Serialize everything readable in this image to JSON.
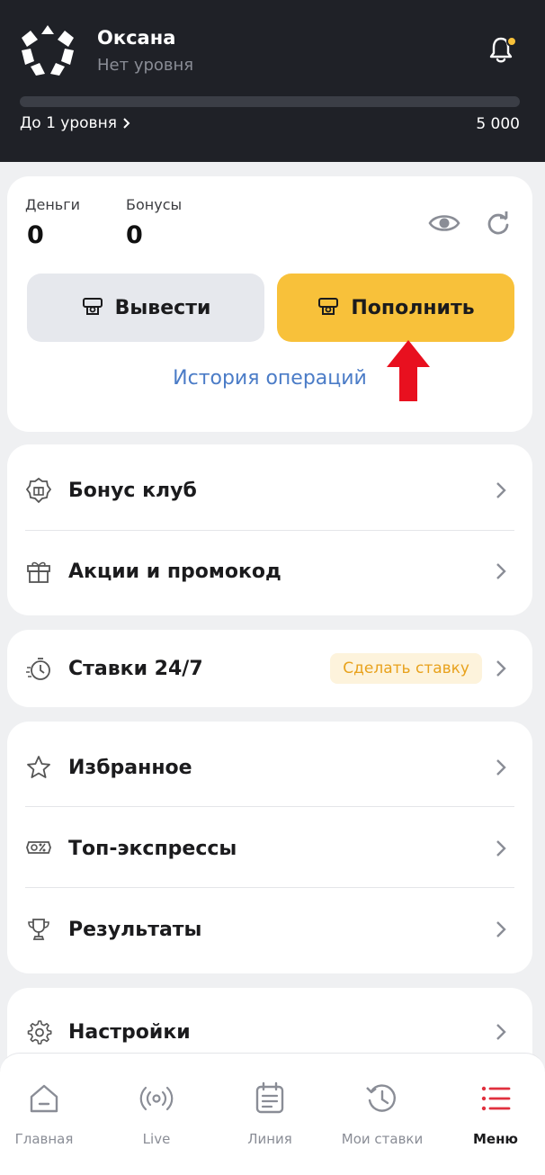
{
  "header": {
    "user_name": "Оксана",
    "user_level": "Нет уровня",
    "level_link": "До 1 уровня",
    "level_target": "5 000",
    "level_progress": 0
  },
  "balance": {
    "money_label": "Деньги",
    "money_value": "0",
    "bonus_label": "Бонусы",
    "bonus_value": "0",
    "withdraw_label": "Вывести",
    "deposit_label": "Пополнить",
    "history_link": "История операций"
  },
  "menu": {
    "group1": [
      {
        "label": "Бонус клуб",
        "icon": "bonus-club-icon"
      },
      {
        "label": "Акции и промокод",
        "icon": "gift-icon"
      }
    ],
    "bets": {
      "label": "Ставки 24/7",
      "badge": "Сделать ставку",
      "icon": "stopwatch-icon"
    },
    "group2": [
      {
        "label": "Избранное",
        "icon": "star-icon"
      },
      {
        "label": "Топ-экспрессы",
        "icon": "top-express-icon"
      },
      {
        "label": "Результаты",
        "icon": "trophy-icon"
      }
    ],
    "settings": {
      "label": "Настройки",
      "icon": "gear-icon"
    }
  },
  "tabbar": [
    {
      "label": "Главная",
      "icon": "home-icon",
      "active": false
    },
    {
      "label": "Live",
      "icon": "live-icon",
      "active": false
    },
    {
      "label": "Линия",
      "icon": "calendar-icon",
      "active": false
    },
    {
      "label": "Мои ставки",
      "icon": "history-icon",
      "active": false
    },
    {
      "label": "Меню",
      "icon": "menu-icon",
      "active": true
    }
  ],
  "colors": {
    "accent": "#f8c13a",
    "header_bg": "#1f2127",
    "link": "#4b7cc7",
    "active_tab": "#e0303e",
    "annotation_arrow": "#e8101f"
  }
}
